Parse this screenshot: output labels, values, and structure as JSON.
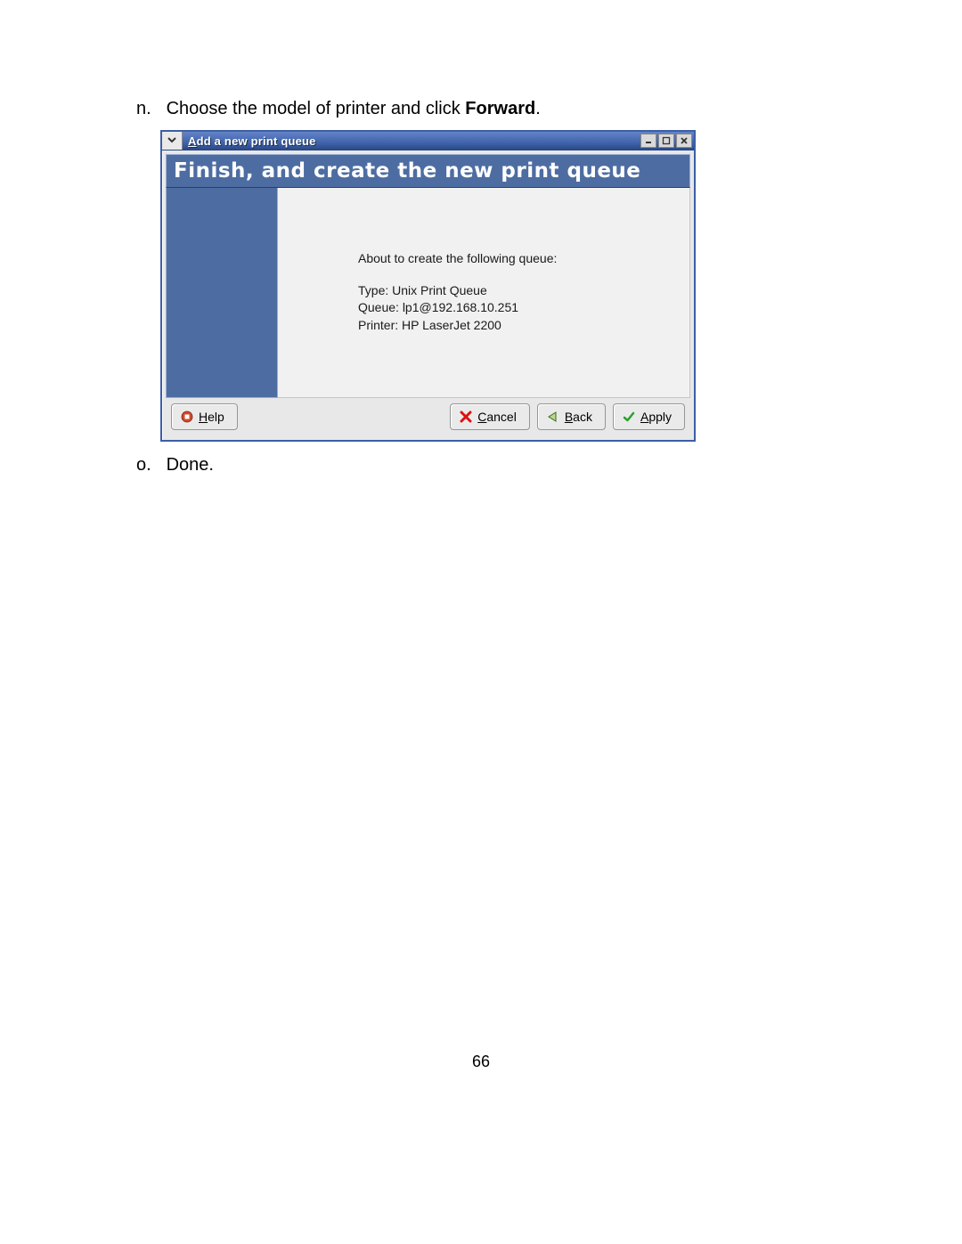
{
  "doc": {
    "step_n_marker": "n.",
    "step_n_text_pre": "Choose the model of printer and click ",
    "step_n_text_bold": "Forward",
    "step_n_text_post": ".",
    "step_o_marker": "o.",
    "step_o_text": "Done.",
    "page_number": "66"
  },
  "window": {
    "title": "Add a new print queue",
    "banner": "Finish, and create the new print queue",
    "content": {
      "intro": "About to create the following queue:",
      "type_line": "Type: Unix Print Queue",
      "queue_line": "Queue: lp1@192.168.10.251",
      "printer_line": "Printer: HP LaserJet 2200"
    },
    "buttons": {
      "help_label": "Help",
      "cancel_label": "Cancel",
      "back_label": "Back",
      "apply_label": "Apply"
    },
    "icons": {
      "menu_chevron": "chevron-down-icon",
      "minimize": "minimize-icon",
      "maximize": "maximize-icon",
      "close": "close-icon",
      "help": "help-icon",
      "cancel": "cancel-x-icon",
      "back": "back-arrow-icon",
      "apply": "check-icon"
    }
  }
}
